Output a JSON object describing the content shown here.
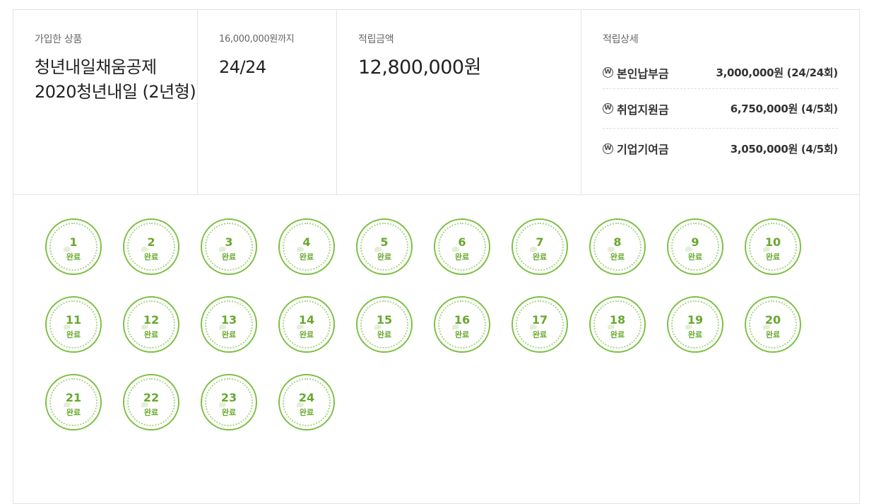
{
  "summary": {
    "product_label": "가입한 상품",
    "product_name": "청년내일채움공제 2020청년내일 (2년형)",
    "limit_label": "16,000,000원까지",
    "count_value": "24/24",
    "amount_label": "적립금액",
    "amount_value": "12,800,000원",
    "detail_label": "적립상세"
  },
  "details": [
    {
      "name": "본인납부금",
      "amount": "3,000,000원 (24/24회)",
      "icon": "won-icon"
    },
    {
      "name": "취업지원금",
      "amount": "6,750,000원 (4/5회)",
      "icon": "won-icon"
    },
    {
      "name": "기업기여금",
      "amount": "3,050,000원 (4/5회)",
      "icon": "won-icon"
    }
  ],
  "stamps": [
    {
      "num": "1",
      "status": "완료"
    },
    {
      "num": "2",
      "status": "완료"
    },
    {
      "num": "3",
      "status": "완료"
    },
    {
      "num": "4",
      "status": "완료"
    },
    {
      "num": "5",
      "status": "완료"
    },
    {
      "num": "6",
      "status": "완료"
    },
    {
      "num": "7",
      "status": "완료"
    },
    {
      "num": "8",
      "status": "완료"
    },
    {
      "num": "9",
      "status": "완료"
    },
    {
      "num": "10",
      "status": "완료"
    },
    {
      "num": "11",
      "status": "완료"
    },
    {
      "num": "12",
      "status": "완료"
    },
    {
      "num": "13",
      "status": "완료"
    },
    {
      "num": "14",
      "status": "완료"
    },
    {
      "num": "15",
      "status": "완료"
    },
    {
      "num": "16",
      "status": "완료"
    },
    {
      "num": "17",
      "status": "완료"
    },
    {
      "num": "18",
      "status": "완료"
    },
    {
      "num": "19",
      "status": "완료"
    },
    {
      "num": "20",
      "status": "완료"
    },
    {
      "num": "21",
      "status": "완료"
    },
    {
      "num": "22",
      "status": "완료"
    },
    {
      "num": "23",
      "status": "완료"
    },
    {
      "num": "24",
      "status": "완료"
    }
  ],
  "colors": {
    "stamp_green": "#7cc043",
    "stamp_text": "#68a82e"
  }
}
